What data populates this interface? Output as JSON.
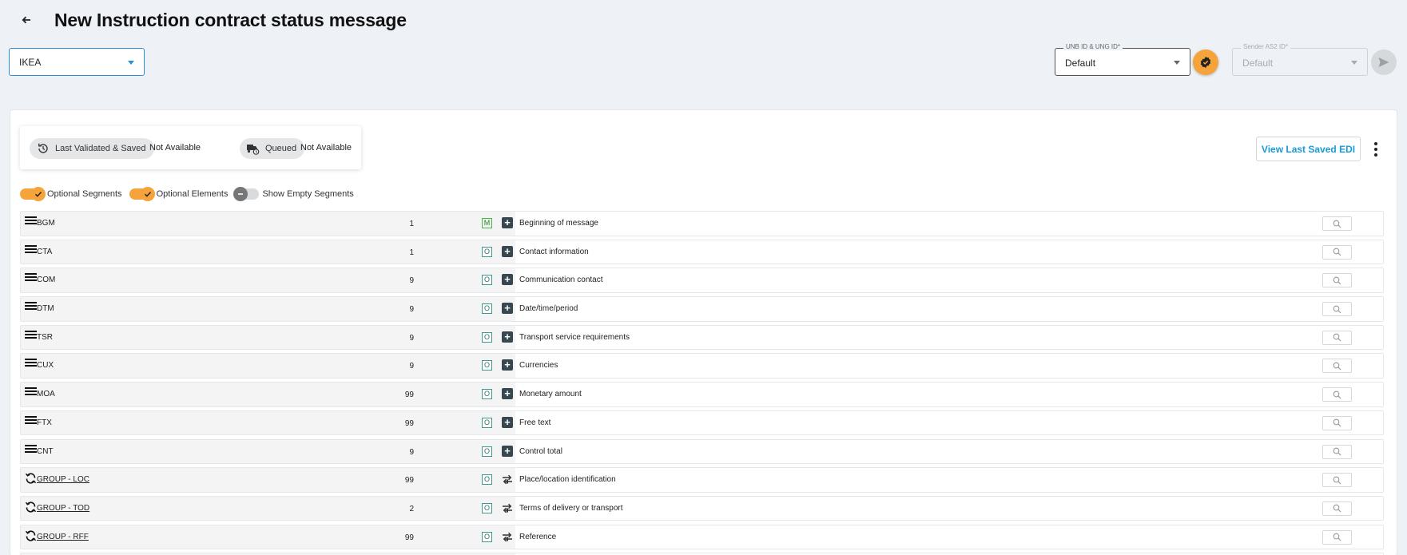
{
  "page": {
    "title": "New Instruction contract status message"
  },
  "partner_select": {
    "value": "IKEA"
  },
  "unb_select": {
    "label": "UNB ID & UNG ID*",
    "value": "Default"
  },
  "as2_select": {
    "label": "Sender AS2 ID*",
    "value": "Default"
  },
  "status": {
    "last_validated_label": "Last Validated & Saved",
    "last_validated_value": "Not Available",
    "queued_label": "Queued",
    "queued_value": "Not Available"
  },
  "actions": {
    "view_edi_label": "View Last Saved EDI"
  },
  "toggles": [
    {
      "label": "Optional Segments",
      "on": true
    },
    {
      "label": "Optional Elements",
      "on": true
    },
    {
      "label": "Show Empty Segments",
      "on": false
    }
  ],
  "segments": [
    {
      "code": "BGM",
      "type": "segment",
      "count": "1",
      "req": "M",
      "desc": "Beginning of message"
    },
    {
      "code": "CTA",
      "type": "segment",
      "count": "1",
      "req": "O",
      "desc": "Contact information"
    },
    {
      "code": "COM",
      "type": "segment",
      "count": "9",
      "req": "O",
      "desc": "Communication contact"
    },
    {
      "code": "DTM",
      "type": "segment",
      "count": "9",
      "req": "O",
      "desc": "Date/time/period"
    },
    {
      "code": "TSR",
      "type": "segment",
      "count": "9",
      "req": "O",
      "desc": "Transport service requirements"
    },
    {
      "code": "CUX",
      "type": "segment",
      "count": "9",
      "req": "O",
      "desc": "Currencies"
    },
    {
      "code": "MOA",
      "type": "segment",
      "count": "99",
      "req": "O",
      "desc": "Monetary amount"
    },
    {
      "code": "FTX",
      "type": "segment",
      "count": "99",
      "req": "O",
      "desc": "Free text"
    },
    {
      "code": "CNT",
      "type": "segment",
      "count": "9",
      "req": "O",
      "desc": "Control total"
    },
    {
      "code": "GROUP - LOC",
      "type": "group",
      "count": "99",
      "req": "O",
      "desc": "Place/location identification"
    },
    {
      "code": "GROUP - TOD",
      "type": "group",
      "count": "2",
      "req": "O",
      "desc": "Terms of delivery or transport"
    },
    {
      "code": "GROUP - RFF",
      "type": "group",
      "count": "99",
      "req": "O",
      "desc": "Reference"
    },
    {
      "code": "",
      "type": "segment",
      "count": "",
      "req": "",
      "desc": ""
    }
  ]
}
